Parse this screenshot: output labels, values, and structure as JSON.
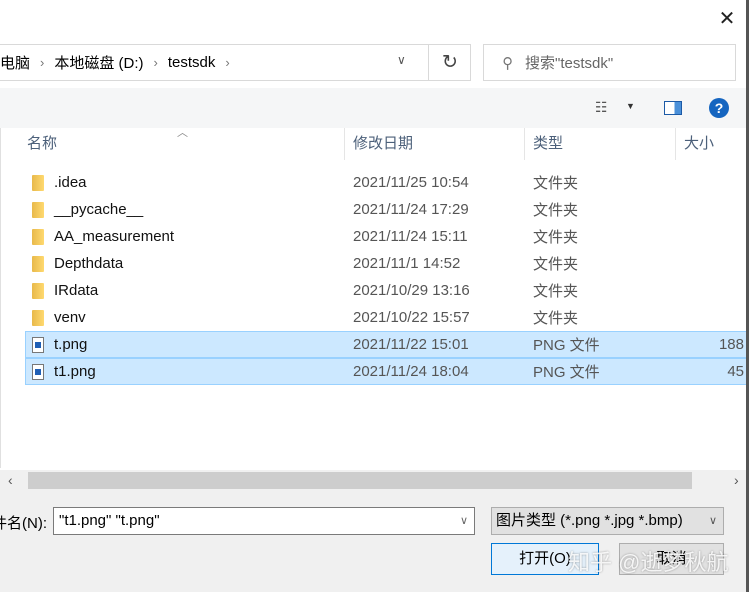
{
  "address": {
    "crumbs": [
      "此电脑",
      "本地磁盘 (D:)",
      "testsdk"
    ]
  },
  "search": {
    "placeholder": "搜索\"testsdk\""
  },
  "columns": {
    "name": "名称",
    "date": "修改日期",
    "type": "类型",
    "size": "大小"
  },
  "files": [
    {
      "name": ".idea",
      "date": "2021/11/25 10:54",
      "type": "文件夹",
      "size": "",
      "kind": "folder",
      "selected": false
    },
    {
      "name": "__pycache__",
      "date": "2021/11/24 17:29",
      "type": "文件夹",
      "size": "",
      "kind": "folder",
      "selected": false
    },
    {
      "name": "AA_measurement",
      "date": "2021/11/24 15:11",
      "type": "文件夹",
      "size": "",
      "kind": "folder",
      "selected": false
    },
    {
      "name": "Depthdata",
      "date": "2021/11/1 14:52",
      "type": "文件夹",
      "size": "",
      "kind": "folder",
      "selected": false
    },
    {
      "name": "IRdata",
      "date": "2021/10/29 13:16",
      "type": "文件夹",
      "size": "",
      "kind": "folder",
      "selected": false
    },
    {
      "name": "venv",
      "date": "2021/10/22 15:57",
      "type": "文件夹",
      "size": "",
      "kind": "folder",
      "selected": false
    },
    {
      "name": "t.png",
      "date": "2021/11/22 15:01",
      "type": "PNG 文件",
      "size": "188",
      "kind": "file",
      "selected": true
    },
    {
      "name": "t1.png",
      "date": "2021/11/24 18:04",
      "type": "PNG 文件",
      "size": "45",
      "kind": "file",
      "selected": true
    }
  ],
  "bottom": {
    "filename_label": "件名(N):",
    "filename_value": "\"t1.png\" \"t.png\"",
    "filter": "图片类型 (*.png *.jpg *.bmp)",
    "open": "打开(O)",
    "cancel": "取消"
  },
  "watermark": "知乎 @逝梦秋航"
}
